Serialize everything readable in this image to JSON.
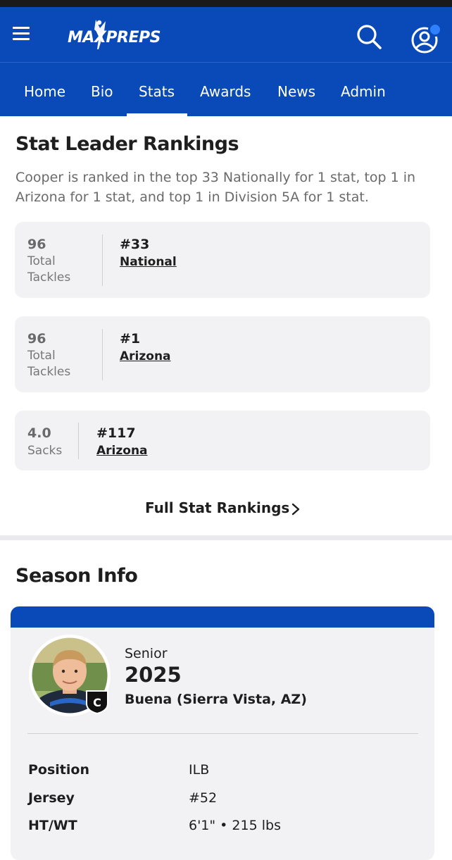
{
  "header": {
    "logo_text": "MAXPREPS",
    "menu_icon": "hamburger-menu-icon",
    "search_icon": "search-icon",
    "profile_icon": "profile-icon",
    "brand_color": "#0a4ab8"
  },
  "tabs": [
    {
      "label": "Home"
    },
    {
      "label": "Bio"
    },
    {
      "label": "Stats",
      "active": true
    },
    {
      "label": "Awards"
    },
    {
      "label": "News"
    },
    {
      "label": "Admin"
    }
  ],
  "stat_leader": {
    "title": "Stat Leader Rankings",
    "description": "Cooper is ranked in the top 33 Nationally for 1 stat, top 1 in Arizona for 1 stat, and top 1 in Division 5A for 1 stat.",
    "cards": [
      {
        "value": "96",
        "label_line1": "Total",
        "label_line2": "Tackles",
        "rank": "#33",
        "region": "National"
      },
      {
        "value": "96",
        "label_line1": "Total",
        "label_line2": "Tackles",
        "rank": "#1",
        "region": "Arizona"
      },
      {
        "value": "4.0",
        "label_line1": "Sacks",
        "label_line2": "",
        "rank": "#117",
        "region": "Arizona"
      }
    ],
    "full_link": "Full Stat Rankings"
  },
  "season_info": {
    "title": "Season Info",
    "class_label": "Senior",
    "year": "2025",
    "school": "Buena (Sierra Vista, AZ)",
    "captain_badge": "C",
    "rows": [
      {
        "key": "Position",
        "value": "ILB"
      },
      {
        "key": "Jersey",
        "value": "#52"
      },
      {
        "key": "HT/WT",
        "value": "6'1\" • 215 lbs"
      }
    ]
  }
}
